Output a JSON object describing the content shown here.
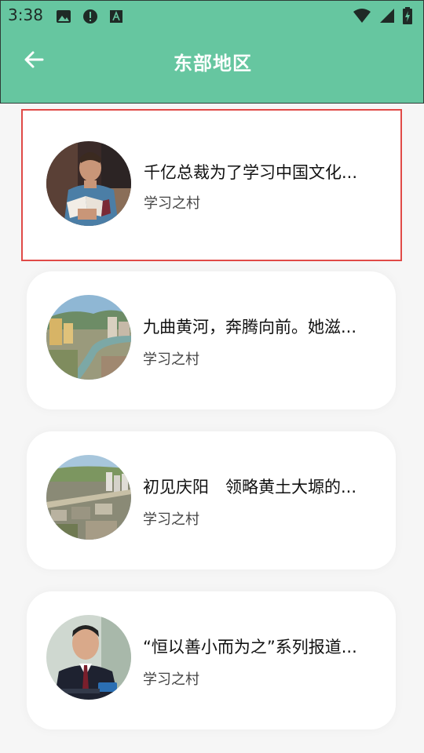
{
  "status_bar": {
    "time": "3:38",
    "left_icons": [
      "image-icon",
      "alert-icon",
      "a-box-icon"
    ],
    "right_icons": [
      "wifi-icon",
      "signal-icon",
      "battery-icon"
    ]
  },
  "header": {
    "title": "东部地区",
    "back_icon": "arrow-left-icon",
    "background": "#66c6a0"
  },
  "articles": [
    {
      "title": "千亿总裁为了学习中国文化...",
      "source": "学习之村",
      "thumbnail": "man-reading-book",
      "selected": true
    },
    {
      "title": "九曲黄河，奔腾向前。她滋...",
      "source": "学习之村",
      "thumbnail": "river-city-aerial",
      "selected": false
    },
    {
      "title": "初见庆阳　领略黄土大塬的...",
      "source": "学习之村",
      "thumbnail": "town-aerial",
      "selected": false
    },
    {
      "title": "“恒以善小而为之”系列报道...",
      "source": "学习之村",
      "thumbnail": "man-in-suit-interview",
      "selected": false
    }
  ],
  "colors": {
    "accent": "#66c6a0",
    "selection_border": "#e04a47",
    "background": "#f6f6f6"
  }
}
